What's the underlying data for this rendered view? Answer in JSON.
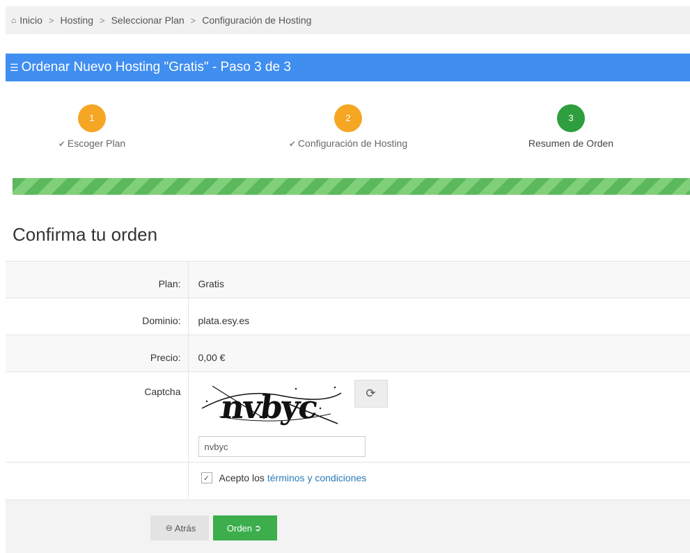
{
  "breadcrumb": {
    "items": [
      "Inicio",
      "Hosting",
      "Seleccionar Plan",
      "Configuración de Hosting"
    ],
    "separator": ">"
  },
  "panel": {
    "title": "Ordenar Nuevo Hosting \"Gratis\" - Paso 3 de 3"
  },
  "steps": [
    {
      "number": "1",
      "label": "Escoger Plan",
      "state": "done"
    },
    {
      "number": "2",
      "label": "Configuración de Hosting",
      "state": "done"
    },
    {
      "number": "3",
      "label": "Resumen de Orden",
      "state": "current"
    }
  ],
  "progress": {
    "fraction": 1.0
  },
  "confirm": {
    "title": "Confirma tu orden",
    "plan_label": "Plan:",
    "plan_value": "Gratis",
    "domain_label": "Dominio:",
    "domain_value": "plata.esy.es",
    "price_label": "Precio:",
    "price_value": "0,00 €",
    "captcha_label": "Captcha",
    "captcha_text": "nvbyc",
    "captcha_input_value": "nvbyc",
    "terms_prefix": "Acepto los",
    "terms_link": "términos y condiciones",
    "terms_checked": true
  },
  "buttons": {
    "back": "Atrás",
    "order": "Orden"
  },
  "colors": {
    "header_blue": "#3f8ef0",
    "step_done": "#f5a623",
    "step_current": "#2e9e3e",
    "progress_green": "#5cb85c",
    "order_button": "#3cae4c",
    "link": "#2a7ab8"
  },
  "icons": {
    "home": "home-icon",
    "menu": "menu-icon",
    "check": "check-icon",
    "refresh": "refresh-icon",
    "back": "circle-arrow-left-icon",
    "order": "circle-arrow-right-icon"
  }
}
